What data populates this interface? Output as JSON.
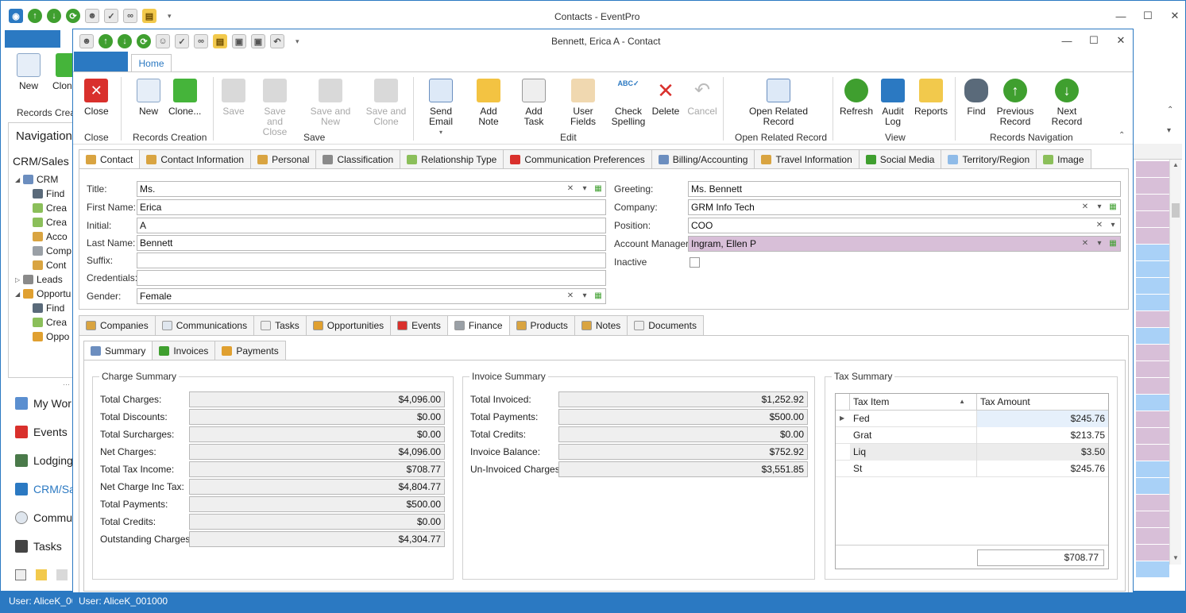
{
  "main_window": {
    "title": "Contacts - EventPro",
    "ribbon_buttons": [
      {
        "label": "New"
      },
      {
        "label": "Clone"
      }
    ],
    "ribbon_group": "Records Creat",
    "nav_title": "Navigation",
    "nav_section": "CRM/Sales",
    "tree": [
      {
        "label": "CRM",
        "level": 0,
        "expand": "◢"
      },
      {
        "label": "Find",
        "level": 1
      },
      {
        "label": "Crea",
        "level": 1
      },
      {
        "label": "Crea",
        "level": 1
      },
      {
        "label": "Acco",
        "level": 1
      },
      {
        "label": "Comp",
        "level": 1
      },
      {
        "label": "Cont",
        "level": 1
      },
      {
        "label": "Leads",
        "level": 0,
        "expand": "▷"
      },
      {
        "label": "Opportu",
        "level": 0,
        "expand": "◢"
      },
      {
        "label": "Find",
        "level": 1
      },
      {
        "label": "Crea",
        "level": 1
      },
      {
        "label": "Oppo",
        "level": 1
      }
    ],
    "nav_groups": [
      "My Wor",
      "Events",
      "Lodging",
      "CRM/Sa",
      "Commu",
      "Tasks"
    ],
    "status_user": "User: AliceK_00"
  },
  "contact_window": {
    "title": "Bennett, Erica A - Contact",
    "ribbon_tab": "Home",
    "ribbon": {
      "groups": [
        {
          "label": "Close",
          "buttons": [
            {
              "label": "Close",
              "enabled": true
            }
          ]
        },
        {
          "label": "Records Creation",
          "buttons": [
            {
              "label": "New",
              "enabled": true
            },
            {
              "label": "Clone...",
              "enabled": true
            }
          ]
        },
        {
          "label": "Save",
          "buttons": [
            {
              "label": "Save",
              "enabled": false
            },
            {
              "label": "Save and Close",
              "enabled": false
            },
            {
              "label": "Save and New",
              "enabled": false
            },
            {
              "label": "Save and Clone",
              "enabled": false
            }
          ]
        },
        {
          "label": "Edit",
          "buttons": [
            {
              "label": "Send Email",
              "enabled": true
            },
            {
              "label": "Add Note",
              "enabled": true
            },
            {
              "label": "Add Task",
              "enabled": true
            },
            {
              "label": "User Fields",
              "enabled": true
            },
            {
              "label": "Check Spelling",
              "enabled": true
            },
            {
              "label": "Delete",
              "enabled": true
            },
            {
              "label": "Cancel",
              "enabled": false
            }
          ]
        },
        {
          "label": "Open Related Record",
          "buttons": [
            {
              "label": "Open Related Record",
              "enabled": true
            }
          ]
        },
        {
          "label": "View",
          "buttons": [
            {
              "label": "Refresh",
              "enabled": true
            },
            {
              "label": "Audit Log",
              "enabled": true
            },
            {
              "label": "Reports",
              "enabled": true
            }
          ]
        },
        {
          "label": "Records Navigation",
          "buttons": [
            {
              "label": "Find",
              "enabled": true
            },
            {
              "label": "Previous Record",
              "enabled": true
            },
            {
              "label": "Next Record",
              "enabled": true
            }
          ]
        }
      ]
    },
    "top_tabs": [
      "Contact",
      "Contact Information",
      "Personal",
      "Classification",
      "Relationship Type",
      "Communication Preferences",
      "Billing/Accounting",
      "Travel Information",
      "Social Media",
      "Territory/Region",
      "Image"
    ],
    "fields_left": [
      {
        "label": "Title:",
        "value": "Ms."
      },
      {
        "label": "First Name:",
        "value": "Erica"
      },
      {
        "label": "Initial:",
        "value": "A"
      },
      {
        "label": "Last Name:",
        "value": "Bennett"
      },
      {
        "label": "Suffix:",
        "value": ""
      },
      {
        "label": "Credentials:",
        "value": ""
      },
      {
        "label": "Gender:",
        "value": "Female"
      }
    ],
    "fields_right": [
      {
        "label": "Greeting:",
        "value": "Ms. Bennett"
      },
      {
        "label": "Company:",
        "value": "GRM Info Tech"
      },
      {
        "label": "Position:",
        "value": "COO"
      },
      {
        "label": "Account Manager:",
        "value": "Ingram, Ellen P"
      },
      {
        "label": "Inactive",
        "value": ""
      }
    ],
    "lower_tabs": [
      "Companies",
      "Communications",
      "Tasks",
      "Opportunities",
      "Events",
      "Finance",
      "Products",
      "Notes",
      "Documents"
    ],
    "finance_tabs": [
      "Summary",
      "Invoices",
      "Payments"
    ],
    "charge_summary": {
      "title": "Charge Summary",
      "rows": [
        {
          "label": "Total Charges:",
          "value": "$4,096.00"
        },
        {
          "label": "Total Discounts:",
          "value": "$0.00"
        },
        {
          "label": "Total Surcharges:",
          "value": "$0.00"
        },
        {
          "label": "Net Charges:",
          "value": "$4,096.00"
        },
        {
          "label": "Total Tax Income:",
          "value": "$708.77"
        },
        {
          "label": "Net Charge Inc Tax:",
          "value": "$4,804.77"
        },
        {
          "label": "Total Payments:",
          "value": "$500.00"
        },
        {
          "label": "Total Credits:",
          "value": "$0.00"
        },
        {
          "label": "Outstanding Charges:",
          "value": "$4,304.77"
        }
      ]
    },
    "invoice_summary": {
      "title": "Invoice Summary",
      "rows": [
        {
          "label": "Total Invoiced:",
          "value": "$1,252.92"
        },
        {
          "label": "Total Payments:",
          "value": "$500.00"
        },
        {
          "label": "Total Credits:",
          "value": "$0.00"
        },
        {
          "label": "Invoice Balance:",
          "value": "$752.92"
        },
        {
          "label": "Un-Invoiced Charges:",
          "value": "$3,551.85"
        }
      ]
    },
    "tax_summary": {
      "title": "Tax Summary",
      "columns": [
        "Tax Item",
        "Tax Amount"
      ],
      "rows": [
        {
          "item": "Fed",
          "amount": "$245.76"
        },
        {
          "item": "Grat",
          "amount": "$213.75"
        },
        {
          "item": "Liq",
          "amount": "$3.50"
        },
        {
          "item": "St",
          "amount": "$245.76"
        }
      ],
      "total": "$708.77"
    },
    "status_user": "User: AliceK_001000"
  },
  "colors": {
    "accent": "#2b79c2",
    "highlight_pink": "#d8bfd8",
    "grid_blue": "#a9d1f7"
  }
}
